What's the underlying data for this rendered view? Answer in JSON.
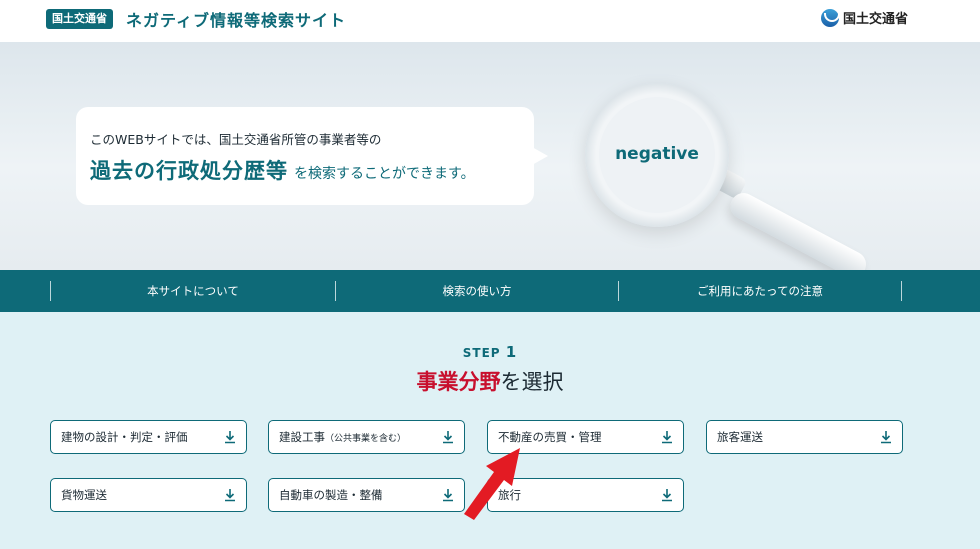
{
  "header": {
    "badge": "国土交通省",
    "site_title": "ネガティブ情報等検索サイト",
    "ministry_name": "国土交通省"
  },
  "hero": {
    "line1": "このWEBサイトでは、国土交通省所管の事業者等の",
    "line2_strong": "過去の行政処分歴等",
    "line2_rest": "を検索することができます。",
    "lens_text": "negative"
  },
  "nav": {
    "items": [
      "本サイトについて",
      "検索の使い方",
      "ご利用にあたっての注意"
    ]
  },
  "step": {
    "label_prefix": "STEP",
    "label_number": "1",
    "heading_strong": "事業分野",
    "heading_rest": "を選択"
  },
  "categories": [
    {
      "label": "建物の設計・判定・評価",
      "note": ""
    },
    {
      "label": "建設工事",
      "note": "（公共事業を含む）"
    },
    {
      "label": "不動産の売買・管理",
      "note": ""
    },
    {
      "label": "旅客運送",
      "note": ""
    },
    {
      "label": "貨物運送",
      "note": ""
    },
    {
      "label": "自動車の製造・整備",
      "note": ""
    },
    {
      "label": "旅行",
      "note": ""
    }
  ],
  "colors": {
    "brand_teal": "#0e6a78",
    "accent_red": "#c8102e",
    "content_bg": "#dff1f5",
    "arrow_red": "#e31b23"
  }
}
